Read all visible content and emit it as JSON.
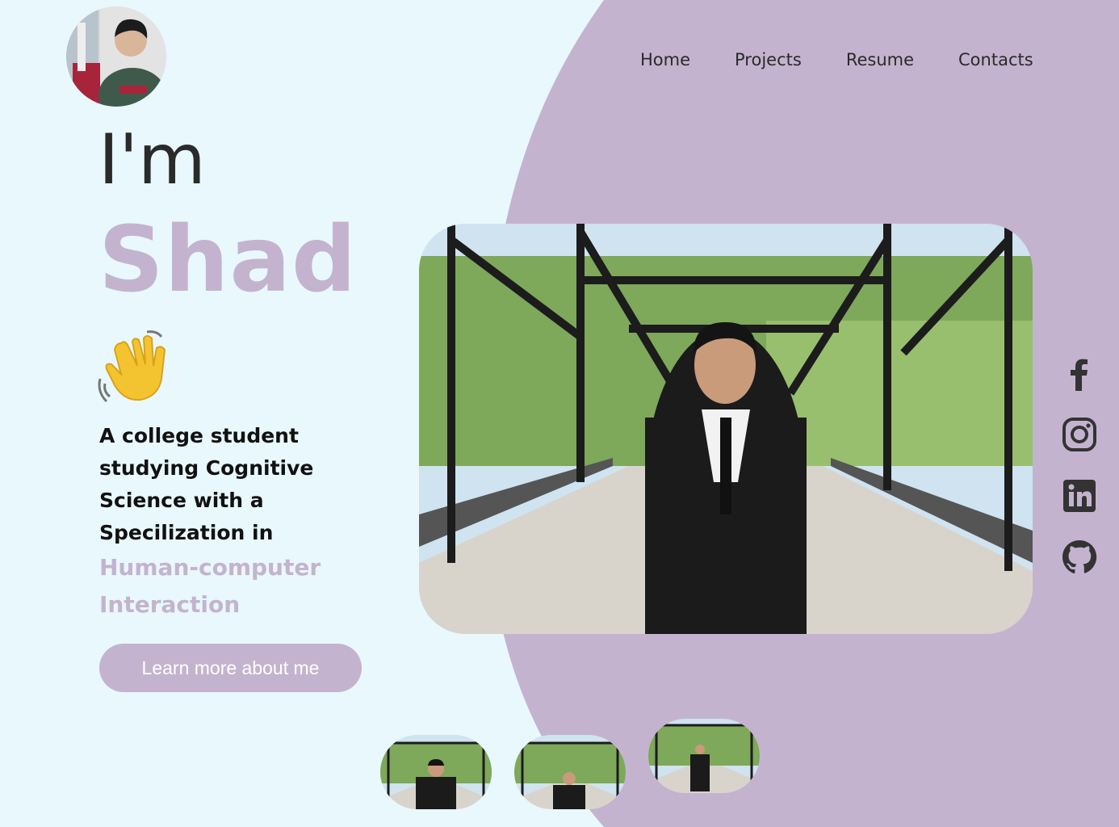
{
  "nav": {
    "items": [
      {
        "label": "Home"
      },
      {
        "label": "Projects"
      },
      {
        "label": "Resume"
      },
      {
        "label": "Contacts"
      }
    ]
  },
  "hero": {
    "greeting": "I'm",
    "name": "Shad",
    "description_lines": [
      "A college student",
      "studying Cognitive",
      "Science with a",
      "Specilization in"
    ],
    "accent_lines": [
      "Human-computer",
      "Interaction"
    ],
    "cta_label": "Learn more about me"
  },
  "social": {
    "icons": [
      "facebook-icon",
      "instagram-icon",
      "linkedin-icon",
      "github-icon"
    ]
  },
  "colors": {
    "background": "#e8f8fc",
    "accent": "#c4b3cf",
    "text": "#2a2a2a"
  }
}
